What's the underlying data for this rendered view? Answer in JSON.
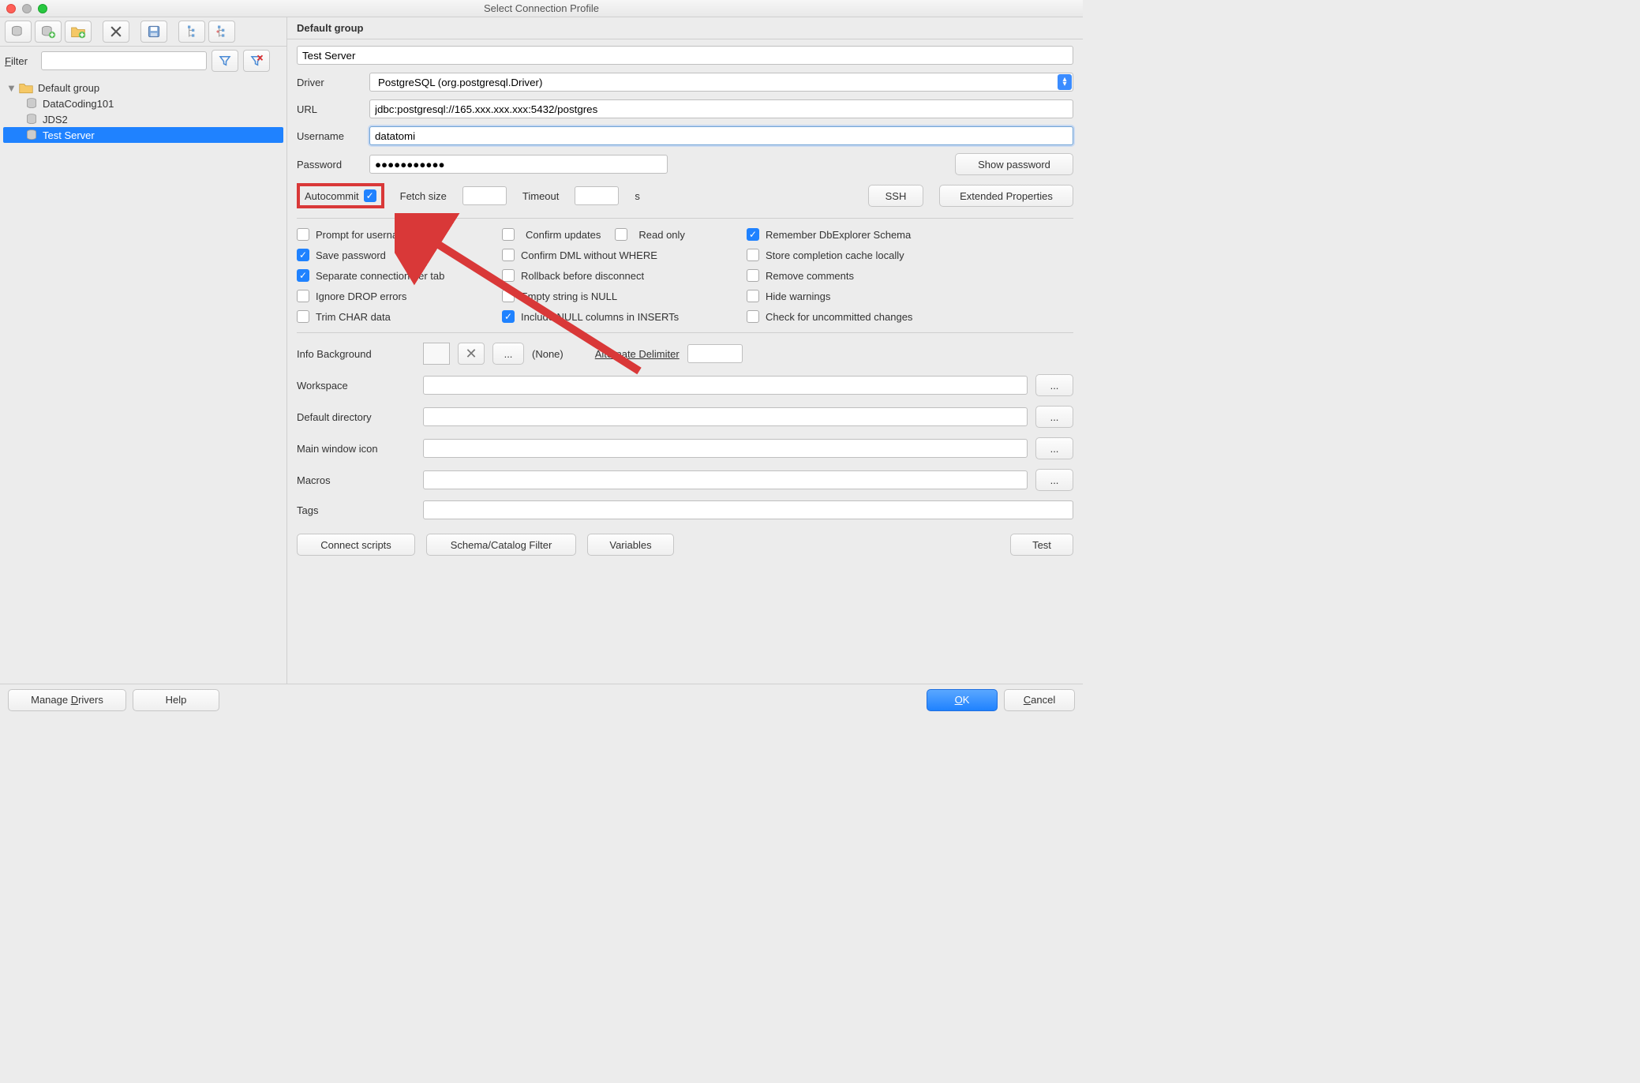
{
  "window": {
    "title": "Select Connection Profile"
  },
  "filter": {
    "label": "Filter",
    "value": ""
  },
  "tree": {
    "group": "Default group",
    "items": [
      "DataCoding101",
      "JDS2",
      "Test Server"
    ],
    "selected": "Test Server"
  },
  "group_header": "Default group",
  "profile_name": "Test Server",
  "labels": {
    "driver": "Driver",
    "url": "URL",
    "username": "Username",
    "password": "Password",
    "show_password": "Show password",
    "autocommit": "Autocommit",
    "fetch_size": "Fetch size",
    "timeout": "Timeout",
    "timeout_unit": "s",
    "ssh": "SSH",
    "extended": "Extended Properties",
    "info_bg": "Info Background",
    "none": "(None)",
    "alt_delim": "Alternate Delimiter",
    "workspace": "Workspace",
    "default_dir": "Default directory",
    "main_icon": "Main window icon",
    "macros": "Macros",
    "tags": "Tags",
    "connect_scripts": "Connect scripts",
    "schema_filter": "Schema/Catalog Filter",
    "variables": "Variables",
    "test": "Test",
    "manage_drivers": "Manage Drivers",
    "help": "Help",
    "ok": "OK",
    "cancel": "Cancel",
    "ellipsis": "..."
  },
  "values": {
    "driver": "PostgreSQL (org.postgresql.Driver)",
    "url": "jdbc:postgresql://165.xxx.xxx.xxx:5432/postgres",
    "username": "datatomi",
    "password": "●●●●●●●●●●●",
    "fetch_size": "",
    "timeout": "",
    "workspace": "",
    "default_dir": "",
    "main_icon": "",
    "macros": "",
    "tags": "",
    "alt_delim": ""
  },
  "options": {
    "col1": [
      {
        "label": "Prompt for username",
        "checked": false
      },
      {
        "label": "Save password",
        "checked": true
      },
      {
        "label": "Separate connection per tab",
        "checked": true
      },
      {
        "label": "Ignore DROP errors",
        "checked": false
      },
      {
        "label": "Trim CHAR data",
        "checked": false
      }
    ],
    "col2": [
      {
        "label": "Confirm updates",
        "checked": false
      },
      {
        "label": "Confirm DML without WHERE",
        "checked": false
      },
      {
        "label": "Rollback before disconnect",
        "checked": false
      },
      {
        "label": "Empty string is NULL",
        "checked": false
      },
      {
        "label": "Include NULL columns in INSERTs",
        "checked": true
      }
    ],
    "col2b": [
      {
        "label": "Read only",
        "checked": false
      }
    ],
    "col3": [
      {
        "label": "Remember DbExplorer Schema",
        "checked": true
      },
      {
        "label": "Store completion cache locally",
        "checked": false
      },
      {
        "label": "Remove comments",
        "checked": false
      },
      {
        "label": "Hide warnings",
        "checked": false
      },
      {
        "label": "Check for uncommitted changes",
        "checked": false
      }
    ]
  }
}
